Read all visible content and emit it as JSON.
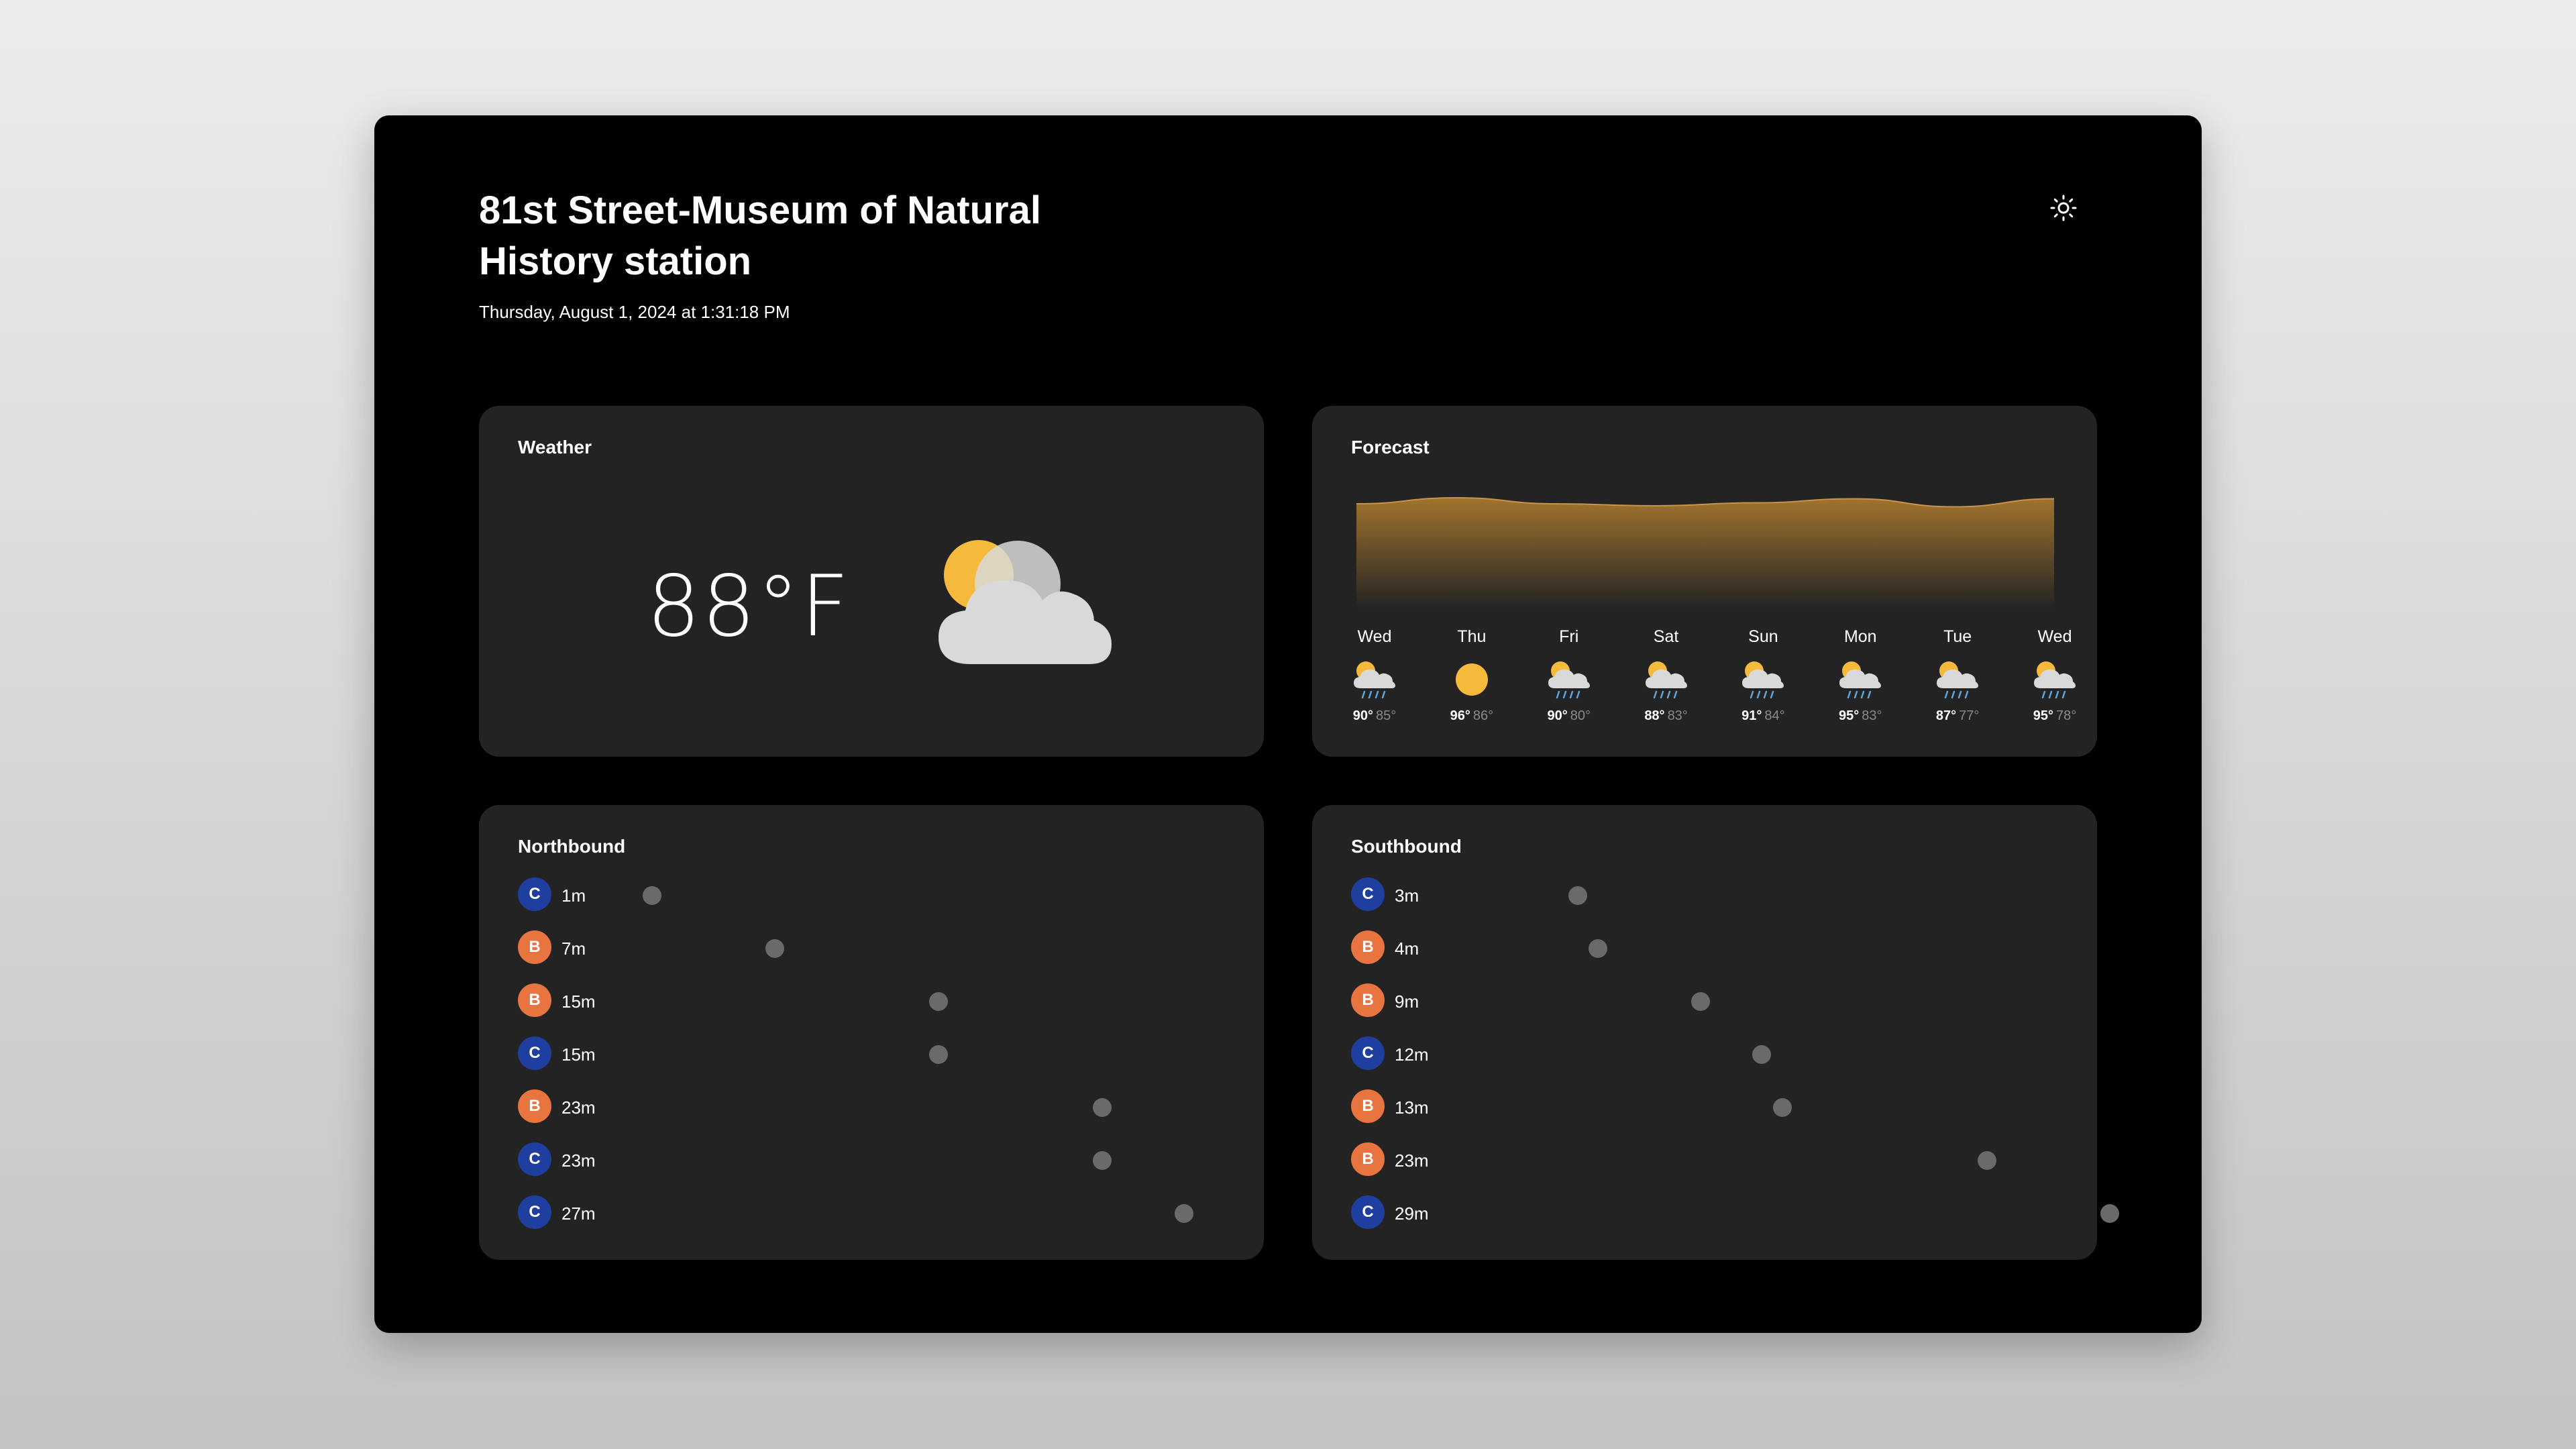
{
  "station": {
    "name": "81st Street-Museum of Natural History station",
    "datetime": "Thursday, August 1, 2024 at 1:31:18 PM"
  },
  "theme_toggle_icon": "sun-icon",
  "weather": {
    "title": "Weather",
    "temperature": "88°F",
    "condition_icon": "partly-cloudy-icon"
  },
  "forecast": {
    "title": "Forecast",
    "days": [
      {
        "day": "Wed",
        "hi": "90°",
        "lo": "85°",
        "icon": "sun-cloud-rain-icon",
        "hi_value": 90
      },
      {
        "day": "Thu",
        "hi": "96°",
        "lo": "86°",
        "icon": "sun-icon",
        "hi_value": 96
      },
      {
        "day": "Fri",
        "hi": "90°",
        "lo": "80°",
        "icon": "sun-cloud-rain-icon",
        "hi_value": 90
      },
      {
        "day": "Sat",
        "hi": "88°",
        "lo": "83°",
        "icon": "sun-cloud-rain-icon",
        "hi_value": 88
      },
      {
        "day": "Sun",
        "hi": "91°",
        "lo": "84°",
        "icon": "sun-cloud-rain-icon",
        "hi_value": 91
      },
      {
        "day": "Mon",
        "hi": "95°",
        "lo": "83°",
        "icon": "sun-cloud-rain-icon",
        "hi_value": 95
      },
      {
        "day": "Tue",
        "hi": "87°",
        "lo": "77°",
        "icon": "sun-cloud-rain-icon",
        "hi_value": 87
      },
      {
        "day": "Wed",
        "hi": "95°",
        "lo": "78°",
        "icon": "sun-cloud-rain-icon",
        "hi_value": 95
      }
    ]
  },
  "northbound": {
    "title": "Northbound",
    "trips": [
      {
        "line": "C",
        "minutes": "1m",
        "minutes_value": 1
      },
      {
        "line": "B",
        "minutes": "7m",
        "minutes_value": 7
      },
      {
        "line": "B",
        "minutes": "15m",
        "minutes_value": 15
      },
      {
        "line": "C",
        "minutes": "15m",
        "minutes_value": 15
      },
      {
        "line": "B",
        "minutes": "23m",
        "minutes_value": 23
      },
      {
        "line": "C",
        "minutes": "23m",
        "minutes_value": 23
      },
      {
        "line": "C",
        "minutes": "27m",
        "minutes_value": 27
      }
    ]
  },
  "southbound": {
    "title": "Southbound",
    "trips": [
      {
        "line": "C",
        "minutes": "3m",
        "minutes_value": 3
      },
      {
        "line": "B",
        "minutes": "4m",
        "minutes_value": 4
      },
      {
        "line": "B",
        "minutes": "9m",
        "minutes_value": 9
      },
      {
        "line": "C",
        "minutes": "12m",
        "minutes_value": 12
      },
      {
        "line": "B",
        "minutes": "13m",
        "minutes_value": 13
      },
      {
        "line": "B",
        "minutes": "23m",
        "minutes_value": 23
      },
      {
        "line": "C",
        "minutes": "29m",
        "minutes_value": 29
      }
    ]
  },
  "line_colors": {
    "C": "#1f3fa0",
    "B": "#e8743f"
  },
  "colors": {
    "background": "#000000",
    "card": "#232323",
    "sun": "#f5b93b",
    "cloud": "#d9d9d9",
    "chart_fill": "#a8782e"
  }
}
